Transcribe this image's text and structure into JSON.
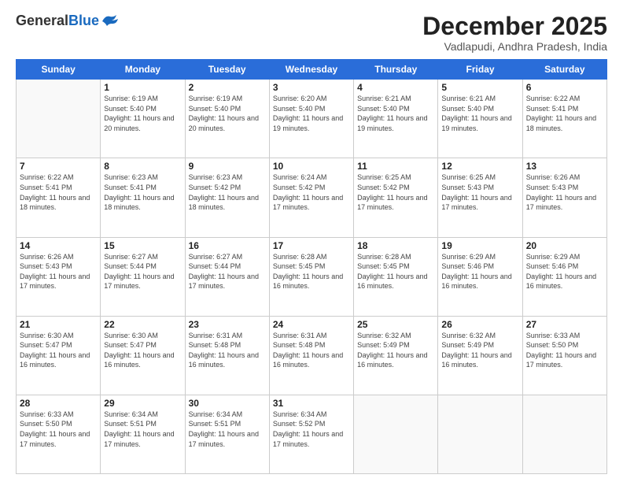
{
  "header": {
    "logo_general": "General",
    "logo_blue": "Blue",
    "month": "December 2025",
    "location": "Vadlapudi, Andhra Pradesh, India"
  },
  "days_of_week": [
    "Sunday",
    "Monday",
    "Tuesday",
    "Wednesday",
    "Thursday",
    "Friday",
    "Saturday"
  ],
  "weeks": [
    [
      {
        "day": "",
        "empty": true
      },
      {
        "day": "1",
        "sunrise": "Sunrise: 6:19 AM",
        "sunset": "Sunset: 5:40 PM",
        "daylight": "Daylight: 11 hours and 20 minutes."
      },
      {
        "day": "2",
        "sunrise": "Sunrise: 6:19 AM",
        "sunset": "Sunset: 5:40 PM",
        "daylight": "Daylight: 11 hours and 20 minutes."
      },
      {
        "day": "3",
        "sunrise": "Sunrise: 6:20 AM",
        "sunset": "Sunset: 5:40 PM",
        "daylight": "Daylight: 11 hours and 19 minutes."
      },
      {
        "day": "4",
        "sunrise": "Sunrise: 6:21 AM",
        "sunset": "Sunset: 5:40 PM",
        "daylight": "Daylight: 11 hours and 19 minutes."
      },
      {
        "day": "5",
        "sunrise": "Sunrise: 6:21 AM",
        "sunset": "Sunset: 5:40 PM",
        "daylight": "Daylight: 11 hours and 19 minutes."
      },
      {
        "day": "6",
        "sunrise": "Sunrise: 6:22 AM",
        "sunset": "Sunset: 5:41 PM",
        "daylight": "Daylight: 11 hours and 18 minutes."
      }
    ],
    [
      {
        "day": "7",
        "sunrise": "Sunrise: 6:22 AM",
        "sunset": "Sunset: 5:41 PM",
        "daylight": "Daylight: 11 hours and 18 minutes."
      },
      {
        "day": "8",
        "sunrise": "Sunrise: 6:23 AM",
        "sunset": "Sunset: 5:41 PM",
        "daylight": "Daylight: 11 hours and 18 minutes."
      },
      {
        "day": "9",
        "sunrise": "Sunrise: 6:23 AM",
        "sunset": "Sunset: 5:42 PM",
        "daylight": "Daylight: 11 hours and 18 minutes."
      },
      {
        "day": "10",
        "sunrise": "Sunrise: 6:24 AM",
        "sunset": "Sunset: 5:42 PM",
        "daylight": "Daylight: 11 hours and 17 minutes."
      },
      {
        "day": "11",
        "sunrise": "Sunrise: 6:25 AM",
        "sunset": "Sunset: 5:42 PM",
        "daylight": "Daylight: 11 hours and 17 minutes."
      },
      {
        "day": "12",
        "sunrise": "Sunrise: 6:25 AM",
        "sunset": "Sunset: 5:43 PM",
        "daylight": "Daylight: 11 hours and 17 minutes."
      },
      {
        "day": "13",
        "sunrise": "Sunrise: 6:26 AM",
        "sunset": "Sunset: 5:43 PM",
        "daylight": "Daylight: 11 hours and 17 minutes."
      }
    ],
    [
      {
        "day": "14",
        "sunrise": "Sunrise: 6:26 AM",
        "sunset": "Sunset: 5:43 PM",
        "daylight": "Daylight: 11 hours and 17 minutes."
      },
      {
        "day": "15",
        "sunrise": "Sunrise: 6:27 AM",
        "sunset": "Sunset: 5:44 PM",
        "daylight": "Daylight: 11 hours and 17 minutes."
      },
      {
        "day": "16",
        "sunrise": "Sunrise: 6:27 AM",
        "sunset": "Sunset: 5:44 PM",
        "daylight": "Daylight: 11 hours and 17 minutes."
      },
      {
        "day": "17",
        "sunrise": "Sunrise: 6:28 AM",
        "sunset": "Sunset: 5:45 PM",
        "daylight": "Daylight: 11 hours and 16 minutes."
      },
      {
        "day": "18",
        "sunrise": "Sunrise: 6:28 AM",
        "sunset": "Sunset: 5:45 PM",
        "daylight": "Daylight: 11 hours and 16 minutes."
      },
      {
        "day": "19",
        "sunrise": "Sunrise: 6:29 AM",
        "sunset": "Sunset: 5:46 PM",
        "daylight": "Daylight: 11 hours and 16 minutes."
      },
      {
        "day": "20",
        "sunrise": "Sunrise: 6:29 AM",
        "sunset": "Sunset: 5:46 PM",
        "daylight": "Daylight: 11 hours and 16 minutes."
      }
    ],
    [
      {
        "day": "21",
        "sunrise": "Sunrise: 6:30 AM",
        "sunset": "Sunset: 5:47 PM",
        "daylight": "Daylight: 11 hours and 16 minutes."
      },
      {
        "day": "22",
        "sunrise": "Sunrise: 6:30 AM",
        "sunset": "Sunset: 5:47 PM",
        "daylight": "Daylight: 11 hours and 16 minutes."
      },
      {
        "day": "23",
        "sunrise": "Sunrise: 6:31 AM",
        "sunset": "Sunset: 5:48 PM",
        "daylight": "Daylight: 11 hours and 16 minutes."
      },
      {
        "day": "24",
        "sunrise": "Sunrise: 6:31 AM",
        "sunset": "Sunset: 5:48 PM",
        "daylight": "Daylight: 11 hours and 16 minutes."
      },
      {
        "day": "25",
        "sunrise": "Sunrise: 6:32 AM",
        "sunset": "Sunset: 5:49 PM",
        "daylight": "Daylight: 11 hours and 16 minutes."
      },
      {
        "day": "26",
        "sunrise": "Sunrise: 6:32 AM",
        "sunset": "Sunset: 5:49 PM",
        "daylight": "Daylight: 11 hours and 16 minutes."
      },
      {
        "day": "27",
        "sunrise": "Sunrise: 6:33 AM",
        "sunset": "Sunset: 5:50 PM",
        "daylight": "Daylight: 11 hours and 17 minutes."
      }
    ],
    [
      {
        "day": "28",
        "sunrise": "Sunrise: 6:33 AM",
        "sunset": "Sunset: 5:50 PM",
        "daylight": "Daylight: 11 hours and 17 minutes."
      },
      {
        "day": "29",
        "sunrise": "Sunrise: 6:34 AM",
        "sunset": "Sunset: 5:51 PM",
        "daylight": "Daylight: 11 hours and 17 minutes."
      },
      {
        "day": "30",
        "sunrise": "Sunrise: 6:34 AM",
        "sunset": "Sunset: 5:51 PM",
        "daylight": "Daylight: 11 hours and 17 minutes."
      },
      {
        "day": "31",
        "sunrise": "Sunrise: 6:34 AM",
        "sunset": "Sunset: 5:52 PM",
        "daylight": "Daylight: 11 hours and 17 minutes."
      },
      {
        "day": "",
        "empty": true
      },
      {
        "day": "",
        "empty": true
      },
      {
        "day": "",
        "empty": true
      }
    ]
  ]
}
